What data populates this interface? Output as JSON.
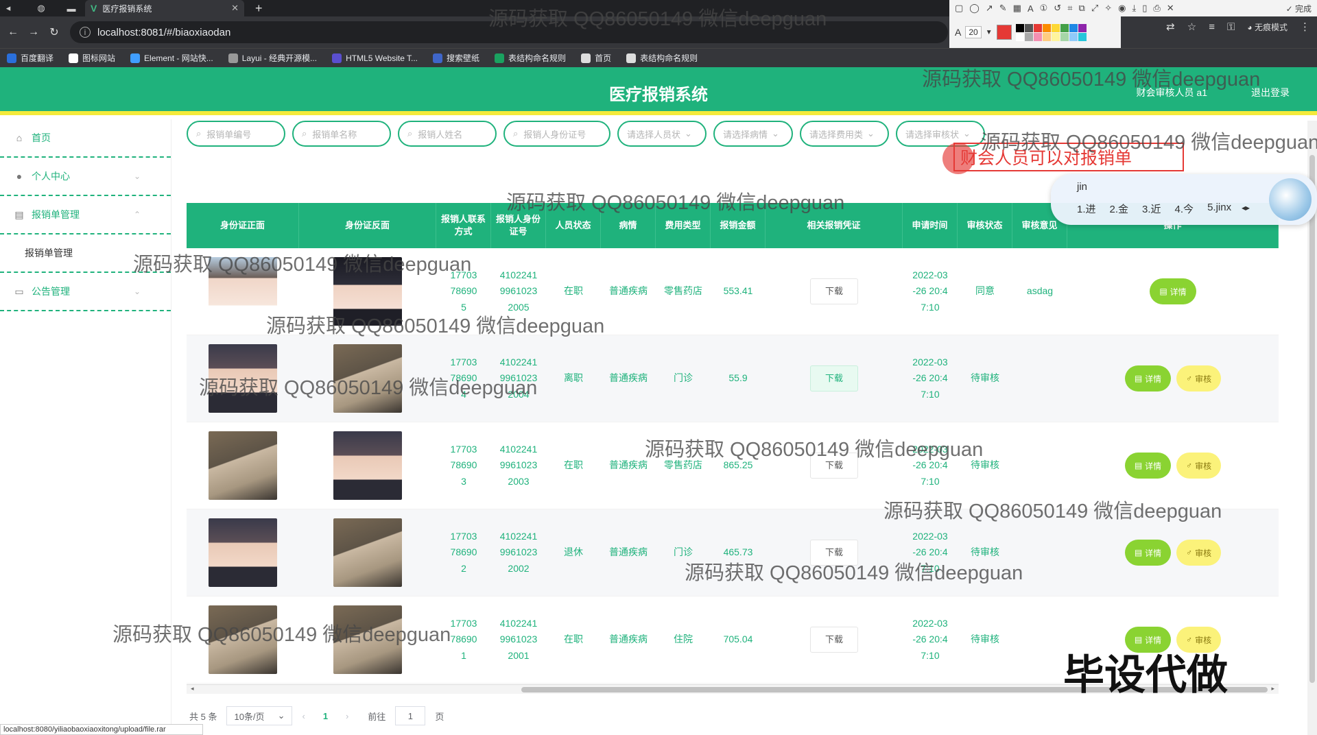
{
  "browser": {
    "tab_title": "医疗报销系统",
    "url": "localhost:8081/#/biaoxiaodan",
    "incognito_label": "无痕模式",
    "bookmarks": [
      {
        "label": "百度翻译",
        "color": "#2a6fdb"
      },
      {
        "label": "图标网站",
        "color": "#ffffff"
      },
      {
        "label": "Element - 网站快...",
        "color": "#409eff"
      },
      {
        "label": "Layui - 经典开源模...",
        "color": "#999999"
      },
      {
        "label": "HTML5 Website T...",
        "color": "#5a4fcf"
      },
      {
        "label": "搜索壁纸",
        "color": "#3f66c9"
      },
      {
        "label": "表结构命名规则",
        "color": "#1aa260"
      },
      {
        "label": "首页",
        "color": "#dddddd"
      },
      {
        "label": "表结构命名规则",
        "color": "#dddddd"
      }
    ],
    "status_url": "localhost:8080/yiliaobaoxiaoxitong/upload/file.rar"
  },
  "annotation_toolbar": {
    "font_size": "20",
    "done_label": "完成",
    "swatch_colors": [
      "#000000",
      "#555555",
      "#e53935",
      "#fb8c00",
      "#fdd835",
      "#43a047",
      "#1e88e5",
      "#8e24aa",
      "#ffffff",
      "#aaaaaa",
      "#f48fb1",
      "#ffcc80",
      "#fff59d",
      "#a5d6a7",
      "#90caf9",
      "#26c6da"
    ]
  },
  "app": {
    "title": "医疗报销系统",
    "user": "财会审核人员 a1",
    "logout": "退出登录",
    "theme_color": "#1fb27c",
    "accent_yellow": "#f4ea3b"
  },
  "sidebar": {
    "items": [
      {
        "label": "首页",
        "icon": "home-icon"
      },
      {
        "label": "个人中心",
        "icon": "user-icon"
      },
      {
        "label": "报销单管理",
        "icon": "list-icon"
      },
      {
        "label": "报销单管理",
        "icon": ""
      },
      {
        "label": "公告管理",
        "icon": "notice-icon"
      }
    ]
  },
  "search": {
    "fields": [
      "报销单编号",
      "报销单名称",
      "报销人姓名",
      "报销人身份证号"
    ],
    "selects": [
      "请选择人员状",
      "请选择病情",
      "请选择费用类",
      "请选择审核状"
    ]
  },
  "overlay": {
    "red_note": "财会人员可以对报销单",
    "ime_input": "jin",
    "ime_candidates": [
      "1.进",
      "2.金",
      "3.近",
      "4.今",
      "5.jinx"
    ]
  },
  "table": {
    "headers": [
      "身份证正面",
      "身份证反面",
      "报销人联系方式",
      "报销人身份证号",
      "人员状态",
      "病情",
      "费用类型",
      "报销金额",
      "相关报销凭证",
      "申请时间",
      "审核状态",
      "审核意见",
      "操作"
    ],
    "download_label": "下载",
    "detail_label": "详情",
    "audit_label": "审核",
    "rows": [
      {
        "phone": "17703786905",
        "idno": "410224199610232005",
        "status": "在职",
        "illness": "普通疾病",
        "fee_type": "零售药店",
        "amount": "553.41",
        "time": "2022-03-26 20:47:10",
        "audit": "同意",
        "opinion": "asdag",
        "front": "ph-c",
        "back": "ph-d",
        "can_audit": false
      },
      {
        "phone": "17703786904",
        "idno": "410224199610232004",
        "status": "离职",
        "illness": "普通疾病",
        "fee_type": "门诊",
        "amount": "55.9",
        "time": "2022-03-26 20:47:10",
        "audit": "待审核",
        "opinion": "",
        "front": "ph-a",
        "back": "ph-b",
        "can_audit": true
      },
      {
        "phone": "17703786903",
        "idno": "410224199610232003",
        "status": "在职",
        "illness": "普通疾病",
        "fee_type": "零售药店",
        "amount": "865.25",
        "time": "2022-03-26 20:47:10",
        "audit": "待审核",
        "opinion": "",
        "front": "ph-b",
        "back": "ph-a",
        "can_audit": true
      },
      {
        "phone": "17703786902",
        "idno": "410224199610232002",
        "status": "退休",
        "illness": "普通疾病",
        "fee_type": "门诊",
        "amount": "465.73",
        "time": "2022-03-26 20:47:10",
        "audit": "待审核",
        "opinion": "",
        "front": "ph-a",
        "back": "ph-b",
        "can_audit": true
      },
      {
        "phone": "17703786901",
        "idno": "410224199610232001",
        "status": "在职",
        "illness": "普通疾病",
        "fee_type": "住院",
        "amount": "705.04",
        "time": "2022-03-26 20:47:10",
        "audit": "待审核",
        "opinion": "",
        "front": "ph-b",
        "back": "ph-b",
        "can_audit": true
      }
    ]
  },
  "pagination": {
    "total": "共 5 条",
    "page_size": "10条/页",
    "current": "1",
    "goto_label": "前往",
    "goto_value": "1",
    "page_suffix": "页"
  },
  "watermarks": {
    "text": "源码获取 QQ86050149 微信deepguan",
    "big": "毕设代做"
  }
}
